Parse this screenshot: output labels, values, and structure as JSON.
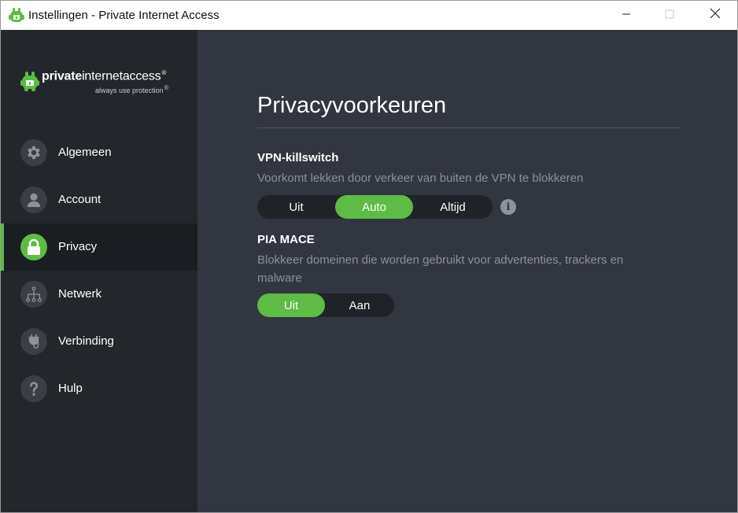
{
  "window": {
    "title": "Instellingen - Private Internet Access",
    "controls": {
      "minimize": "minimize-icon",
      "maximize": "maximize-icon",
      "close": "close-icon"
    }
  },
  "brand": {
    "name_bold": "private",
    "name_rest": "internetaccess",
    "registered": "®",
    "tagline": "always use protection",
    "tagline_mark": "®"
  },
  "sidebar": {
    "items": [
      {
        "label": "Algemeen",
        "icon": "gear-icon",
        "active": false
      },
      {
        "label": "Account",
        "icon": "user-icon",
        "active": false
      },
      {
        "label": "Privacy",
        "icon": "lock-icon",
        "active": true
      },
      {
        "label": "Netwerk",
        "icon": "network-icon",
        "active": false
      },
      {
        "label": "Verbinding",
        "icon": "plug-icon",
        "active": false
      },
      {
        "label": "Hulp",
        "icon": "question-icon",
        "active": false
      }
    ]
  },
  "main": {
    "title": "Privacyvoorkeuren",
    "killswitch": {
      "title": "VPN-killswitch",
      "description": "Voorkomt lekken door verkeer van buiten de VPN te blokkeren",
      "options": [
        "Uit",
        "Auto",
        "Altijd"
      ],
      "selected": "Auto",
      "info_icon": "info-icon"
    },
    "mace": {
      "title": "PIA MACE",
      "description": "Blokkeer domeinen die worden gebruikt voor advertenties, trackers en malware",
      "options": [
        "Uit",
        "Aan"
      ],
      "selected": "Uit"
    }
  },
  "colors": {
    "accent": "#5dbb46",
    "sidebar_bg": "#23262b",
    "main_bg": "#323640",
    "muted_text": "#8c9098"
  }
}
